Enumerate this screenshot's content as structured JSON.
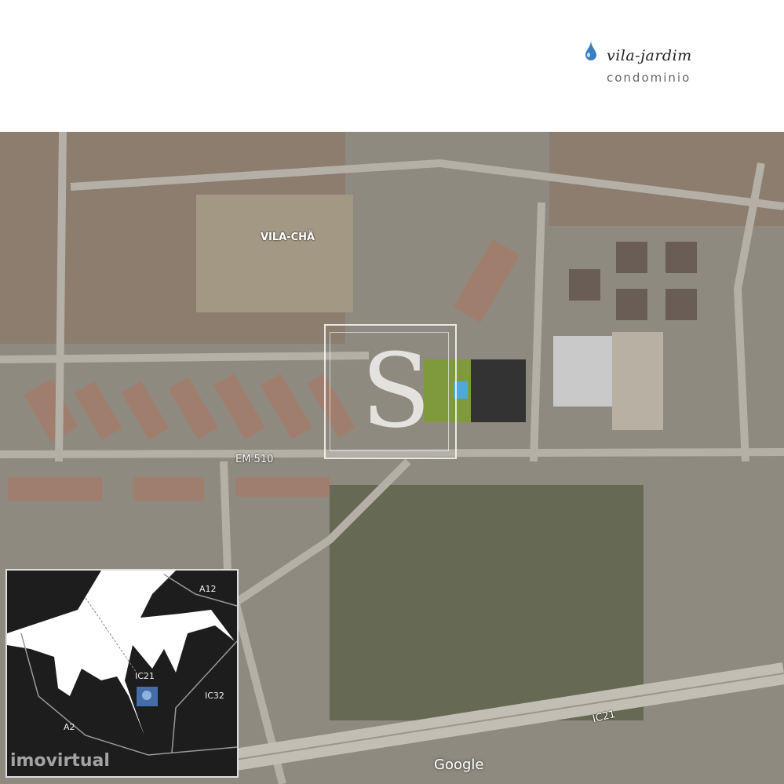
{
  "logo": {
    "name": "vila-jardim",
    "subtitle": "condominio",
    "icon": "water-drop-icon",
    "color": "#3a7fc4"
  },
  "map": {
    "labels": {
      "neighborhood": "VILA-CHÃ",
      "road_main": "EM 510",
      "road_highway": "IC21"
    },
    "site_marker": "S",
    "attribution": "Google"
  },
  "inset": {
    "labels": {
      "a12": "A12",
      "ic21": "IC21",
      "ic32": "IC32",
      "a2": "A2"
    },
    "watermark": "imovirtual",
    "marker_color": "#4a78b8"
  }
}
